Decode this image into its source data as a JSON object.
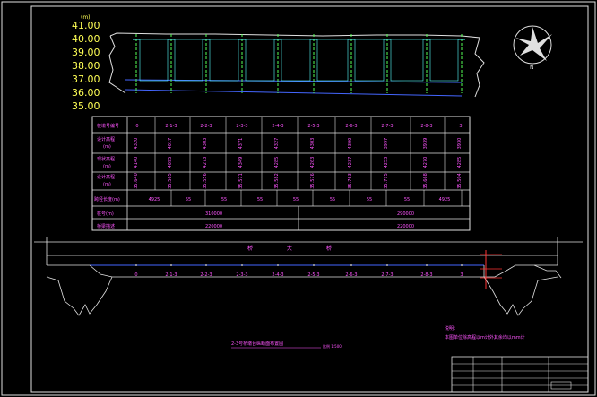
{
  "drawing": {
    "elevation_axis": {
      "unit": "(m)",
      "ticks": [
        "41.00",
        "40.00",
        "39.00",
        "38.00",
        "37.00",
        "36.00",
        "35.00"
      ]
    },
    "table": {
      "row_headers": [
        "桩墩号编号",
        "设计高程",
        "(m)",
        "现状高程",
        "(m)",
        "设计高程",
        "(m)",
        "跨径长度(m)",
        "桩号(m)",
        "桥梁描述"
      ],
      "stations": [
        "0",
        "2-1-3",
        "2-2-3",
        "2-3-3",
        "2-4-3",
        "2-5-3",
        "2-6-3",
        "2-7-3",
        "2-8-3",
        "3"
      ],
      "row2": [
        "4320",
        "4017",
        "4303",
        "4371",
        "4327",
        "4303",
        "4300",
        "3997",
        "3939",
        "3930"
      ],
      "row3": [
        "4140",
        "4095",
        "4273",
        "4349",
        "4285",
        "4263",
        "4237",
        "4253",
        "4270",
        "4285"
      ],
      "row4": [
        "35.640",
        "35.565",
        "35.556",
        "35.571",
        "35.582",
        "35.576",
        "35.763",
        "35.775",
        "35.668",
        "35.504"
      ],
      "spans": [
        "4925",
        "55",
        "55",
        "55",
        "55",
        "55",
        "55",
        "55",
        "4925"
      ],
      "stake_left": "310000",
      "stake_right": "290000",
      "desc_left": "220000",
      "desc_right": "220000"
    },
    "plan": {
      "bridge_label": "桥 大 桥",
      "pier_labels": [
        "0",
        "2-1-3",
        "2-2-3",
        "2-3-3",
        "2-4-3",
        "2-5-3",
        "2-6-3",
        "2-7-3",
        "2-8-3",
        "3"
      ]
    },
    "notes": {
      "title": "说明：",
      "line1": "本图单位除高程以m计外其余均以mm计"
    },
    "drawing_title": "2-3号桥墩台纵断面布置图",
    "scale_note": "比例 1:500",
    "compass_label": "N"
  }
}
